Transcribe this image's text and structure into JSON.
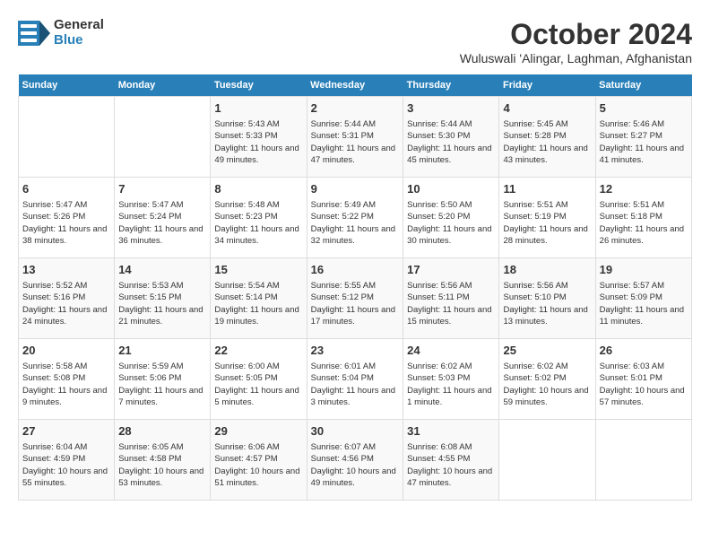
{
  "header": {
    "logo_general": "General",
    "logo_blue": "Blue",
    "month": "October 2024",
    "location": "Wuluswali 'Alingar, Laghman, Afghanistan"
  },
  "days_of_week": [
    "Sunday",
    "Monday",
    "Tuesday",
    "Wednesday",
    "Thursday",
    "Friday",
    "Saturday"
  ],
  "weeks": [
    [
      {
        "day": "",
        "detail": ""
      },
      {
        "day": "",
        "detail": ""
      },
      {
        "day": "1",
        "detail": "Sunrise: 5:43 AM\nSunset: 5:33 PM\nDaylight: 11 hours and 49 minutes."
      },
      {
        "day": "2",
        "detail": "Sunrise: 5:44 AM\nSunset: 5:31 PM\nDaylight: 11 hours and 47 minutes."
      },
      {
        "day": "3",
        "detail": "Sunrise: 5:44 AM\nSunset: 5:30 PM\nDaylight: 11 hours and 45 minutes."
      },
      {
        "day": "4",
        "detail": "Sunrise: 5:45 AM\nSunset: 5:28 PM\nDaylight: 11 hours and 43 minutes."
      },
      {
        "day": "5",
        "detail": "Sunrise: 5:46 AM\nSunset: 5:27 PM\nDaylight: 11 hours and 41 minutes."
      }
    ],
    [
      {
        "day": "6",
        "detail": "Sunrise: 5:47 AM\nSunset: 5:26 PM\nDaylight: 11 hours and 38 minutes."
      },
      {
        "day": "7",
        "detail": "Sunrise: 5:47 AM\nSunset: 5:24 PM\nDaylight: 11 hours and 36 minutes."
      },
      {
        "day": "8",
        "detail": "Sunrise: 5:48 AM\nSunset: 5:23 PM\nDaylight: 11 hours and 34 minutes."
      },
      {
        "day": "9",
        "detail": "Sunrise: 5:49 AM\nSunset: 5:22 PM\nDaylight: 11 hours and 32 minutes."
      },
      {
        "day": "10",
        "detail": "Sunrise: 5:50 AM\nSunset: 5:20 PM\nDaylight: 11 hours and 30 minutes."
      },
      {
        "day": "11",
        "detail": "Sunrise: 5:51 AM\nSunset: 5:19 PM\nDaylight: 11 hours and 28 minutes."
      },
      {
        "day": "12",
        "detail": "Sunrise: 5:51 AM\nSunset: 5:18 PM\nDaylight: 11 hours and 26 minutes."
      }
    ],
    [
      {
        "day": "13",
        "detail": "Sunrise: 5:52 AM\nSunset: 5:16 PM\nDaylight: 11 hours and 24 minutes."
      },
      {
        "day": "14",
        "detail": "Sunrise: 5:53 AM\nSunset: 5:15 PM\nDaylight: 11 hours and 21 minutes."
      },
      {
        "day": "15",
        "detail": "Sunrise: 5:54 AM\nSunset: 5:14 PM\nDaylight: 11 hours and 19 minutes."
      },
      {
        "day": "16",
        "detail": "Sunrise: 5:55 AM\nSunset: 5:12 PM\nDaylight: 11 hours and 17 minutes."
      },
      {
        "day": "17",
        "detail": "Sunrise: 5:56 AM\nSunset: 5:11 PM\nDaylight: 11 hours and 15 minutes."
      },
      {
        "day": "18",
        "detail": "Sunrise: 5:56 AM\nSunset: 5:10 PM\nDaylight: 11 hours and 13 minutes."
      },
      {
        "day": "19",
        "detail": "Sunrise: 5:57 AM\nSunset: 5:09 PM\nDaylight: 11 hours and 11 minutes."
      }
    ],
    [
      {
        "day": "20",
        "detail": "Sunrise: 5:58 AM\nSunset: 5:08 PM\nDaylight: 11 hours and 9 minutes."
      },
      {
        "day": "21",
        "detail": "Sunrise: 5:59 AM\nSunset: 5:06 PM\nDaylight: 11 hours and 7 minutes."
      },
      {
        "day": "22",
        "detail": "Sunrise: 6:00 AM\nSunset: 5:05 PM\nDaylight: 11 hours and 5 minutes."
      },
      {
        "day": "23",
        "detail": "Sunrise: 6:01 AM\nSunset: 5:04 PM\nDaylight: 11 hours and 3 minutes."
      },
      {
        "day": "24",
        "detail": "Sunrise: 6:02 AM\nSunset: 5:03 PM\nDaylight: 11 hours and 1 minute."
      },
      {
        "day": "25",
        "detail": "Sunrise: 6:02 AM\nSunset: 5:02 PM\nDaylight: 10 hours and 59 minutes."
      },
      {
        "day": "26",
        "detail": "Sunrise: 6:03 AM\nSunset: 5:01 PM\nDaylight: 10 hours and 57 minutes."
      }
    ],
    [
      {
        "day": "27",
        "detail": "Sunrise: 6:04 AM\nSunset: 4:59 PM\nDaylight: 10 hours and 55 minutes."
      },
      {
        "day": "28",
        "detail": "Sunrise: 6:05 AM\nSunset: 4:58 PM\nDaylight: 10 hours and 53 minutes."
      },
      {
        "day": "29",
        "detail": "Sunrise: 6:06 AM\nSunset: 4:57 PM\nDaylight: 10 hours and 51 minutes."
      },
      {
        "day": "30",
        "detail": "Sunrise: 6:07 AM\nSunset: 4:56 PM\nDaylight: 10 hours and 49 minutes."
      },
      {
        "day": "31",
        "detail": "Sunrise: 6:08 AM\nSunset: 4:55 PM\nDaylight: 10 hours and 47 minutes."
      },
      {
        "day": "",
        "detail": ""
      },
      {
        "day": "",
        "detail": ""
      }
    ]
  ]
}
